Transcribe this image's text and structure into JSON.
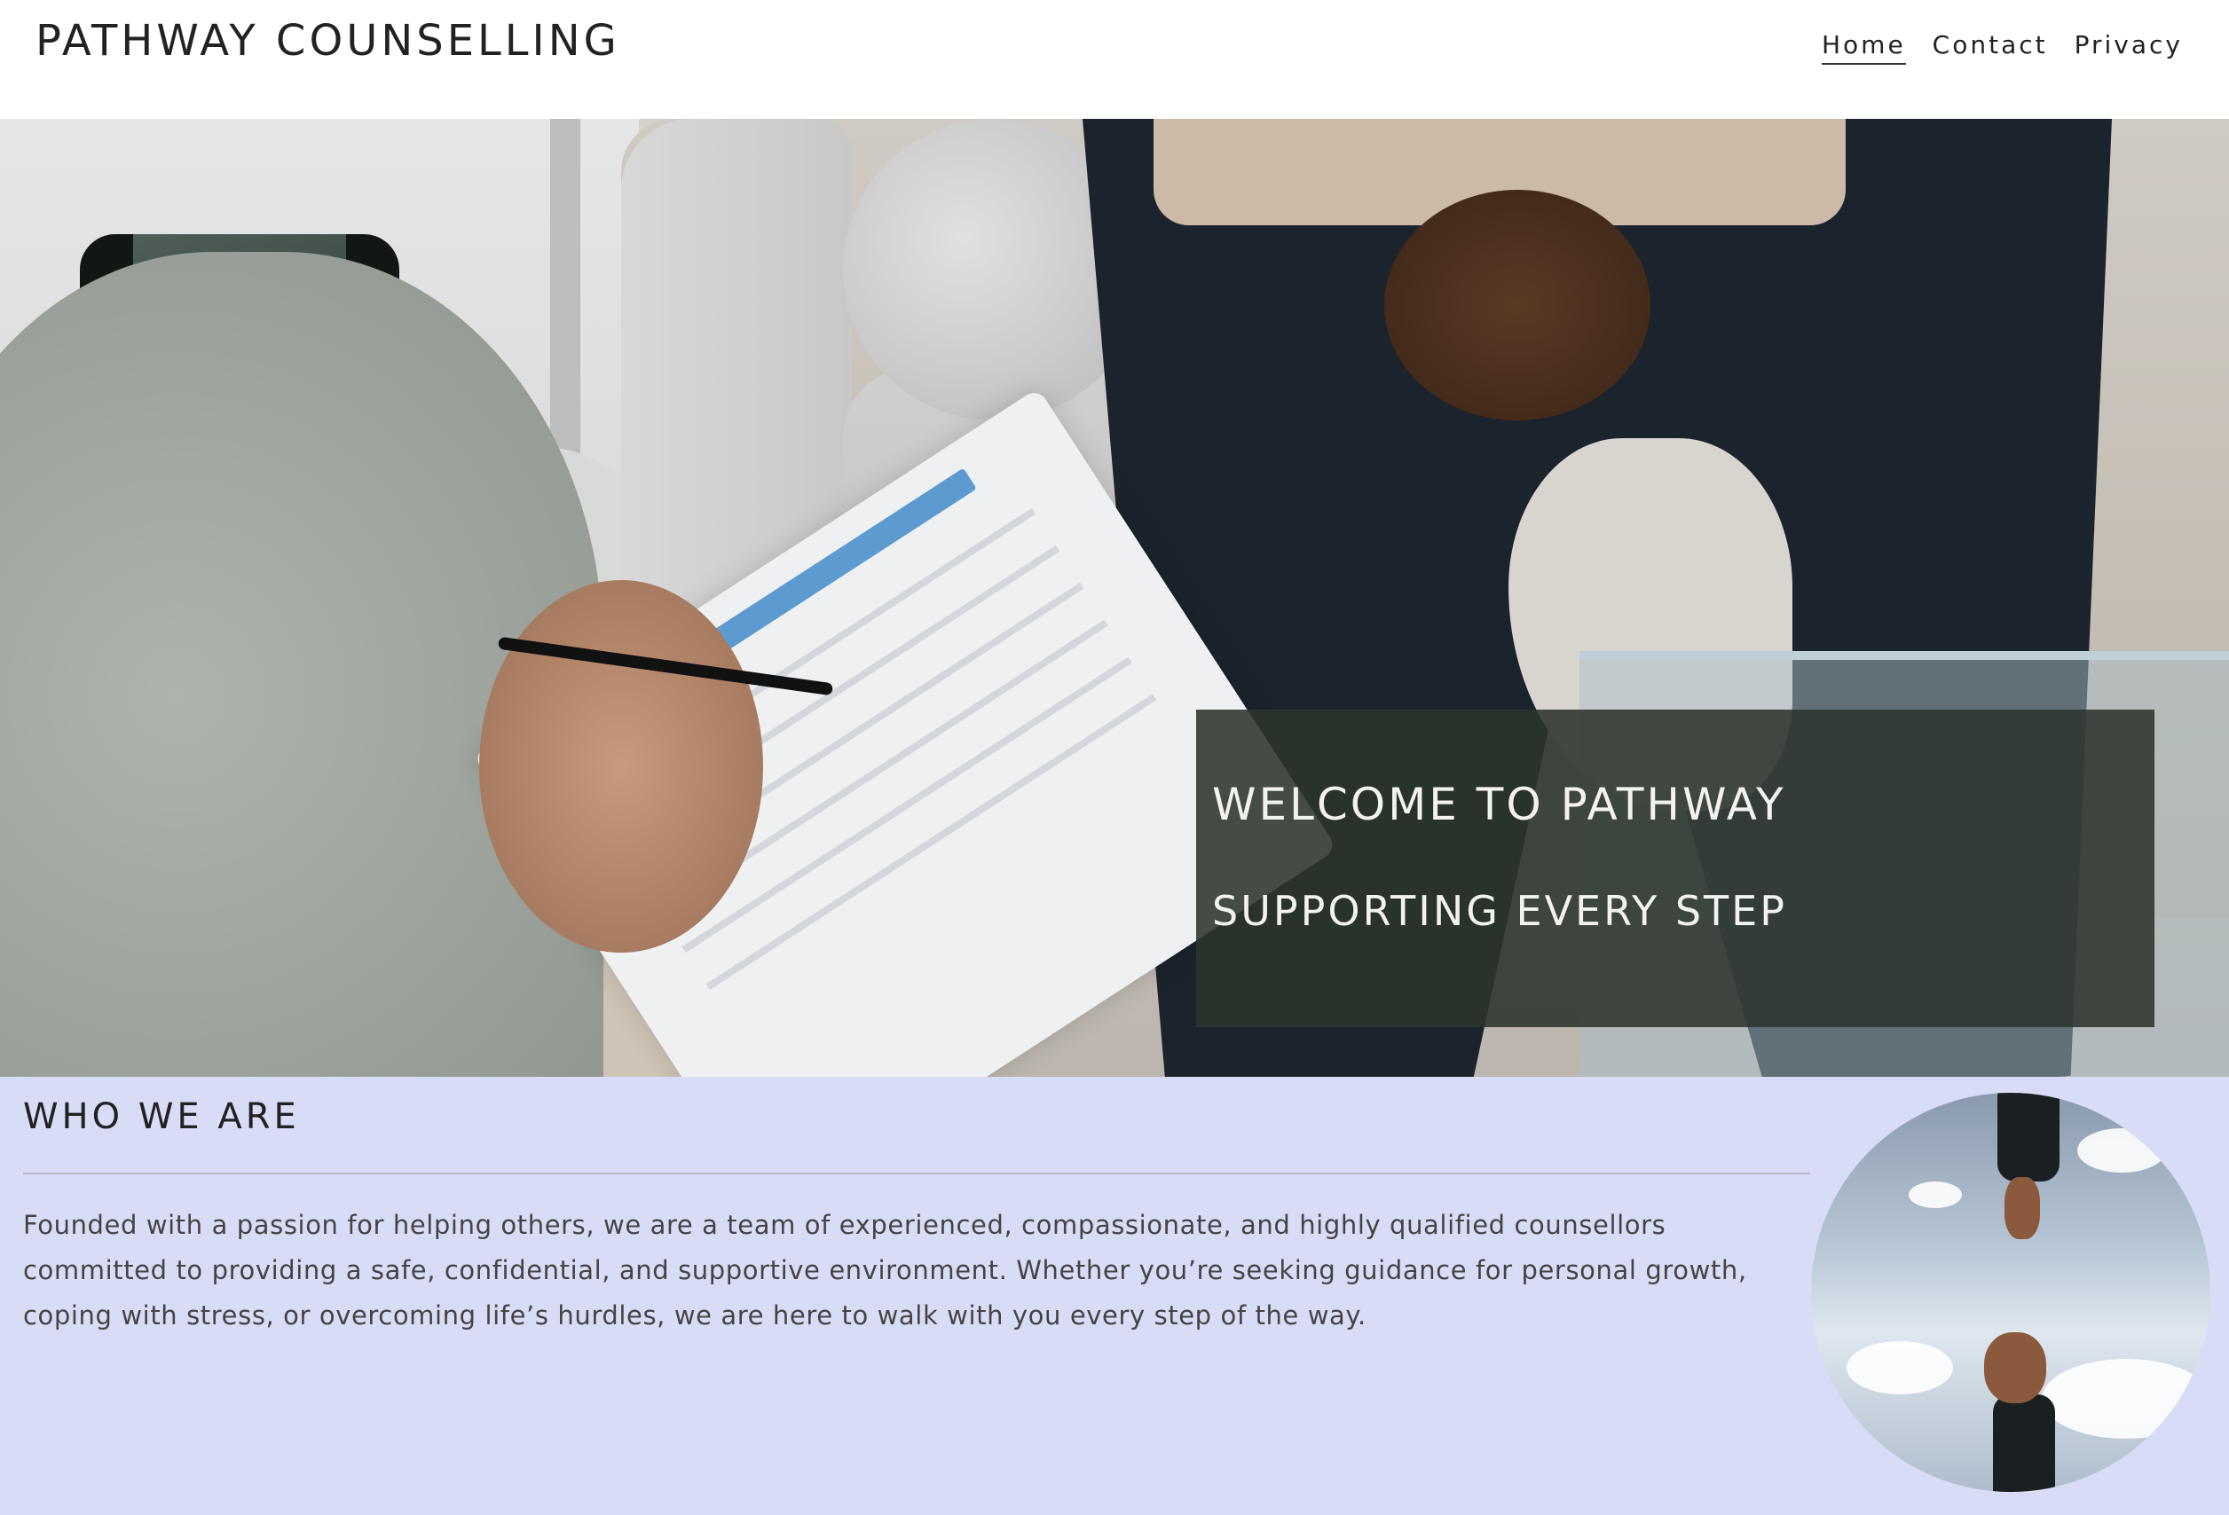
{
  "header": {
    "brand": "PATHWAY COUNSELLING",
    "nav": [
      {
        "label": "Home",
        "active": true
      },
      {
        "label": "Contact",
        "active": false
      },
      {
        "label": "Privacy",
        "active": false
      }
    ]
  },
  "hero": {
    "title": "WELCOME TO PATHWAY",
    "subtitle": "SUPPORTING EVERY STEP"
  },
  "about": {
    "title": "WHO WE ARE",
    "body": "Founded with a passion for helping others, we are a team of experienced, compassionate, and highly qualified counsellors committed to providing a safe, confidential, and supportive environment. Whether you’re seeking guidance for personal growth, coping with stress, or overcoming life’s hurdles, we are here to walk with you every step of the way."
  },
  "colors": {
    "header_bg": "#ffffff",
    "welcome_box": "#2c342c",
    "about_bg": "#d9dcf6",
    "text": "#222222"
  },
  "icons": {
    "hero_image": "counselling-session-photo",
    "about_image": "reaching-hands-photo"
  }
}
